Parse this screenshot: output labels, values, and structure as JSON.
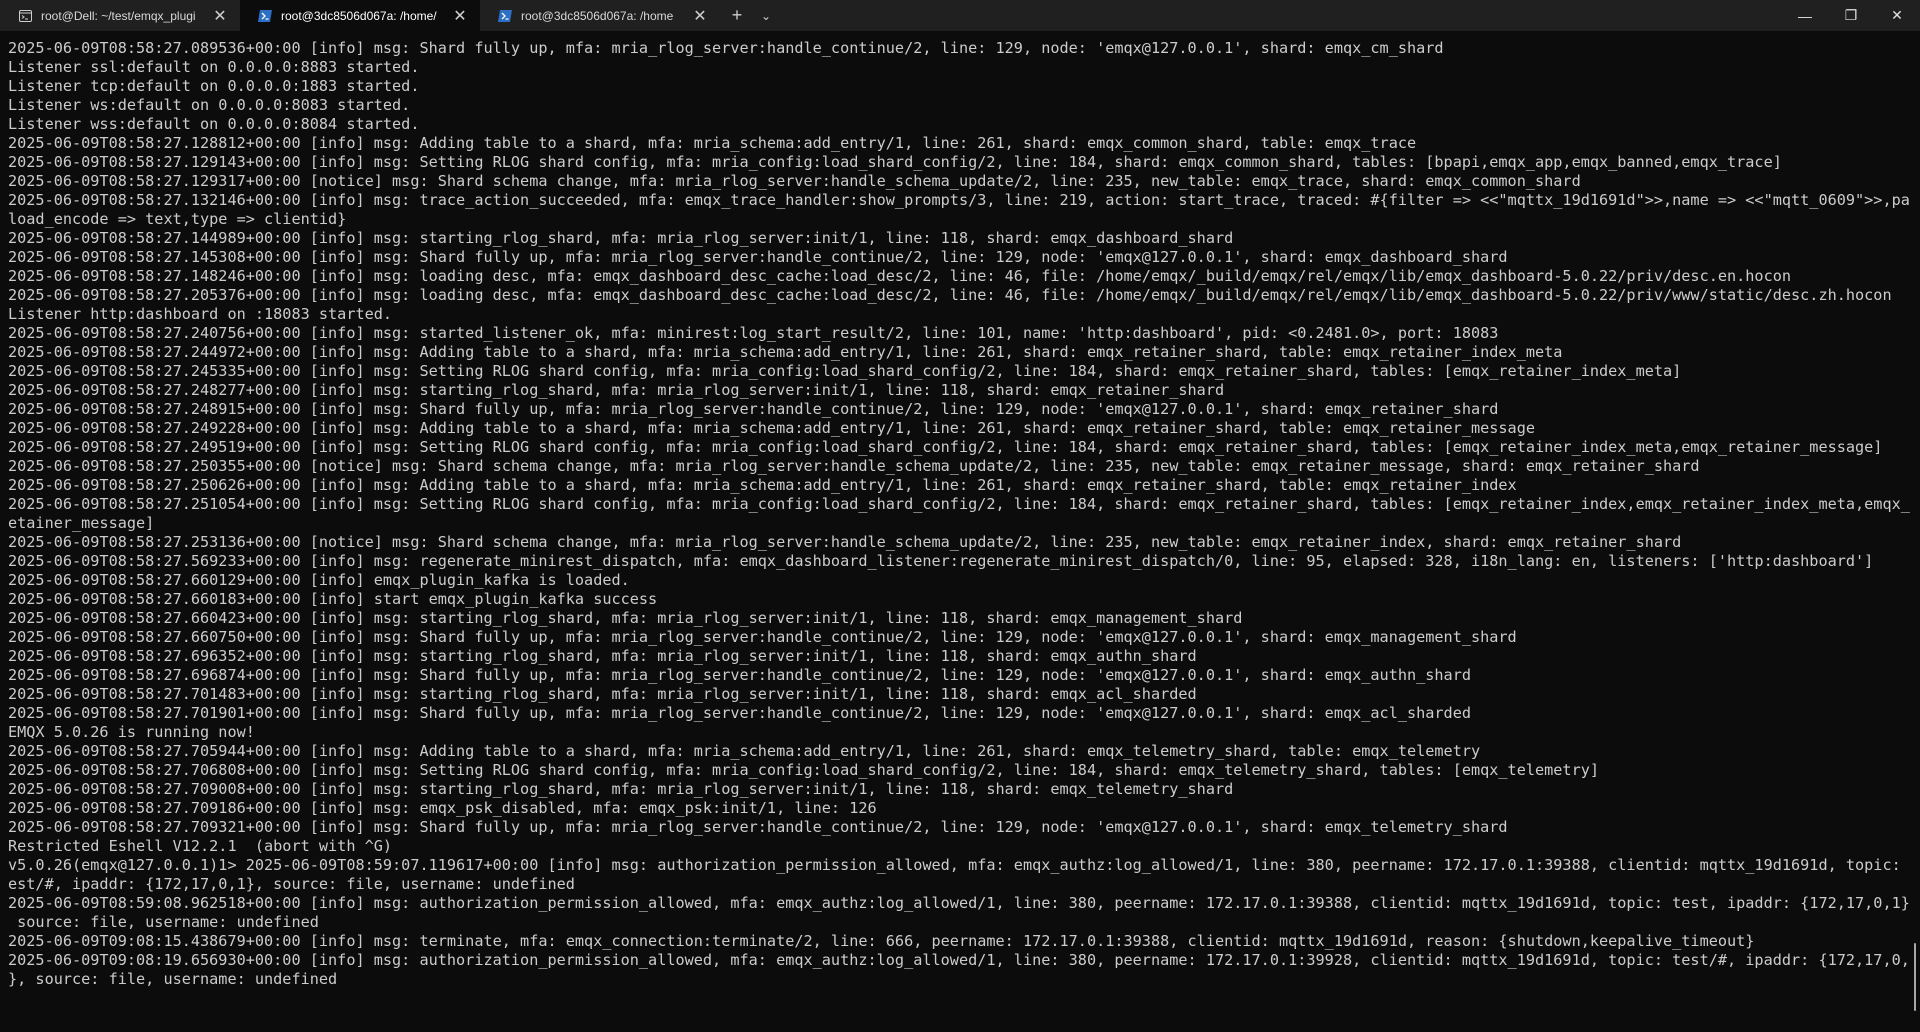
{
  "tabs": [
    {
      "title": "root@Dell: ~/test/emqx_plugi",
      "icon": "linux-terminal-icon",
      "active": false
    },
    {
      "title": "root@3dc8506d067a: /home/",
      "icon": "powershell-icon",
      "active": true
    },
    {
      "title": "root@3dc8506d067a: /home",
      "icon": "powershell-icon",
      "active": false
    }
  ],
  "toolbar": {
    "new_tab": "+",
    "dropdown": "⌄",
    "minimize": "—",
    "maximize": "❐",
    "close": "✕",
    "tab_close": "✕"
  },
  "terminal": {
    "lines": [
      "2025-06-09T08:58:27.089536+00:00 [info] msg: Shard fully up, mfa: mria_rlog_server:handle_continue/2, line: 129, node: 'emqx@127.0.0.1', shard: emqx_cm_shard",
      "Listener ssl:default on 0.0.0.0:8883 started.",
      "Listener tcp:default on 0.0.0.0:1883 started.",
      "Listener ws:default on 0.0.0.0:8083 started.",
      "Listener wss:default on 0.0.0.0:8084 started.",
      "2025-06-09T08:58:27.128812+00:00 [info] msg: Adding table to a shard, mfa: mria_schema:add_entry/1, line: 261, shard: emqx_common_shard, table: emqx_trace",
      "2025-06-09T08:58:27.129143+00:00 [info] msg: Setting RLOG shard config, mfa: mria_config:load_shard_config/2, line: 184, shard: emqx_common_shard, tables: [bpapi,emqx_app,emqx_banned,emqx_trace]",
      "2025-06-09T08:58:27.129317+00:00 [notice] msg: Shard schema change, mfa: mria_rlog_server:handle_schema_update/2, line: 235, new_table: emqx_trace, shard: emqx_common_shard",
      "2025-06-09T08:58:27.132146+00:00 [info] msg: trace_action_succeeded, mfa: emqx_trace_handler:show_prompts/3, line: 219, action: start_trace, traced: #{filter => <<\"mqttx_19d1691d\">>,name => <<\"mqtt_0609\">>,pay",
      "load_encode => text,type => clientid}",
      "2025-06-09T08:58:27.144989+00:00 [info] msg: starting_rlog_shard, mfa: mria_rlog_server:init/1, line: 118, shard: emqx_dashboard_shard",
      "2025-06-09T08:58:27.145308+00:00 [info] msg: Shard fully up, mfa: mria_rlog_server:handle_continue/2, line: 129, node: 'emqx@127.0.0.1', shard: emqx_dashboard_shard",
      "2025-06-09T08:58:27.148246+00:00 [info] msg: loading desc, mfa: emqx_dashboard_desc_cache:load_desc/2, line: 46, file: /home/emqx/_build/emqx/rel/emqx/lib/emqx_dashboard-5.0.22/priv/desc.en.hocon",
      "2025-06-09T08:58:27.205376+00:00 [info] msg: loading desc, mfa: emqx_dashboard_desc_cache:load_desc/2, line: 46, file: /home/emqx/_build/emqx/rel/emqx/lib/emqx_dashboard-5.0.22/priv/www/static/desc.zh.hocon",
      "Listener http:dashboard on :18083 started.",
      "2025-06-09T08:58:27.240756+00:00 [info] msg: started_listener_ok, mfa: minirest:log_start_result/2, line: 101, name: 'http:dashboard', pid: <0.2481.0>, port: 18083",
      "2025-06-09T08:58:27.244972+00:00 [info] msg: Adding table to a shard, mfa: mria_schema:add_entry/1, line: 261, shard: emqx_retainer_shard, table: emqx_retainer_index_meta",
      "2025-06-09T08:58:27.245335+00:00 [info] msg: Setting RLOG shard config, mfa: mria_config:load_shard_config/2, line: 184, shard: emqx_retainer_shard, tables: [emqx_retainer_index_meta]",
      "2025-06-09T08:58:27.248277+00:00 [info] msg: starting_rlog_shard, mfa: mria_rlog_server:init/1, line: 118, shard: emqx_retainer_shard",
      "2025-06-09T08:58:27.248915+00:00 [info] msg: Shard fully up, mfa: mria_rlog_server:handle_continue/2, line: 129, node: 'emqx@127.0.0.1', shard: emqx_retainer_shard",
      "2025-06-09T08:58:27.249228+00:00 [info] msg: Adding table to a shard, mfa: mria_schema:add_entry/1, line: 261, shard: emqx_retainer_shard, table: emqx_retainer_message",
      "2025-06-09T08:58:27.249519+00:00 [info] msg: Setting RLOG shard config, mfa: mria_config:load_shard_config/2, line: 184, shard: emqx_retainer_shard, tables: [emqx_retainer_index_meta,emqx_retainer_message]",
      "2025-06-09T08:58:27.250355+00:00 [notice] msg: Shard schema change, mfa: mria_rlog_server:handle_schema_update/2, line: 235, new_table: emqx_retainer_message, shard: emqx_retainer_shard",
      "2025-06-09T08:58:27.250626+00:00 [info] msg: Adding table to a shard, mfa: mria_schema:add_entry/1, line: 261, shard: emqx_retainer_shard, table: emqx_retainer_index",
      "2025-06-09T08:58:27.251054+00:00 [info] msg: Setting RLOG shard config, mfa: mria_config:load_shard_config/2, line: 184, shard: emqx_retainer_shard, tables: [emqx_retainer_index,emqx_retainer_index_meta,emqx_r",
      "etainer_message]",
      "2025-06-09T08:58:27.253136+00:00 [notice] msg: Shard schema change, mfa: mria_rlog_server:handle_schema_update/2, line: 235, new_table: emqx_retainer_index, shard: emqx_retainer_shard",
      "2025-06-09T08:58:27.569233+00:00 [info] msg: regenerate_minirest_dispatch, mfa: emqx_dashboard_listener:regenerate_minirest_dispatch/0, line: 95, elapsed: 328, i18n_lang: en, listeners: ['http:dashboard']",
      "2025-06-09T08:58:27.660129+00:00 [info] emqx_plugin_kafka is loaded.",
      "2025-06-09T08:58:27.660183+00:00 [info] start emqx_plugin_kafka success",
      "2025-06-09T08:58:27.660423+00:00 [info] msg: starting_rlog_shard, mfa: mria_rlog_server:init/1, line: 118, shard: emqx_management_shard",
      "2025-06-09T08:58:27.660750+00:00 [info] msg: Shard fully up, mfa: mria_rlog_server:handle_continue/2, line: 129, node: 'emqx@127.0.0.1', shard: emqx_management_shard",
      "2025-06-09T08:58:27.696352+00:00 [info] msg: starting_rlog_shard, mfa: mria_rlog_server:init/1, line: 118, shard: emqx_authn_shard",
      "2025-06-09T08:58:27.696874+00:00 [info] msg: Shard fully up, mfa: mria_rlog_server:handle_continue/2, line: 129, node: 'emqx@127.0.0.1', shard: emqx_authn_shard",
      "2025-06-09T08:58:27.701483+00:00 [info] msg: starting_rlog_shard, mfa: mria_rlog_server:init/1, line: 118, shard: emqx_acl_sharded",
      "2025-06-09T08:58:27.701901+00:00 [info] msg: Shard fully up, mfa: mria_rlog_server:handle_continue/2, line: 129, node: 'emqx@127.0.0.1', shard: emqx_acl_sharded",
      "EMQX 5.0.26 is running now!",
      "2025-06-09T08:58:27.705944+00:00 [info] msg: Adding table to a shard, mfa: mria_schema:add_entry/1, line: 261, shard: emqx_telemetry_shard, table: emqx_telemetry",
      "2025-06-09T08:58:27.706808+00:00 [info] msg: Setting RLOG shard config, mfa: mria_config:load_shard_config/2, line: 184, shard: emqx_telemetry_shard, tables: [emqx_telemetry]",
      "2025-06-09T08:58:27.709008+00:00 [info] msg: starting_rlog_shard, mfa: mria_rlog_server:init/1, line: 118, shard: emqx_telemetry_shard",
      "2025-06-09T08:58:27.709186+00:00 [info] msg: emqx_psk_disabled, mfa: emqx_psk:init/1, line: 126",
      "2025-06-09T08:58:27.709321+00:00 [info] msg: Shard fully up, mfa: mria_rlog_server:handle_continue/2, line: 129, node: 'emqx@127.0.0.1', shard: emqx_telemetry_shard",
      "Restricted Eshell V12.2.1  (abort with ^G)",
      "v5.0.26(emqx@127.0.0.1)1> 2025-06-09T08:59:07.119617+00:00 [info] msg: authorization_permission_allowed, mfa: emqx_authz:log_allowed/1, line: 380, peername: 172.17.0.1:39388, clientid: mqttx_19d1691d, topic: t",
      "est/#, ipaddr: {172,17,0,1}, source: file, username: undefined",
      "2025-06-09T08:59:08.962518+00:00 [info] msg: authorization_permission_allowed, mfa: emqx_authz:log_allowed/1, line: 380, peername: 172.17.0.1:39388, clientid: mqttx_19d1691d, topic: test, ipaddr: {172,17,0,1},",
      " source: file, username: undefined",
      "2025-06-09T09:08:15.438679+00:00 [info] msg: terminate, mfa: emqx_connection:terminate/2, line: 666, peername: 172.17.0.1:39388, clientid: mqttx_19d1691d, reason: {shutdown,keepalive_timeout}",
      "2025-06-09T09:08:19.656930+00:00 [info] msg: authorization_permission_allowed, mfa: emqx_authz:log_allowed/1, line: 380, peername: 172.17.0.1:39928, clientid: mqttx_19d1691d, topic: test/#, ipaddr: {172,17,0,1",
      "}, source: file, username: undefined"
    ]
  }
}
